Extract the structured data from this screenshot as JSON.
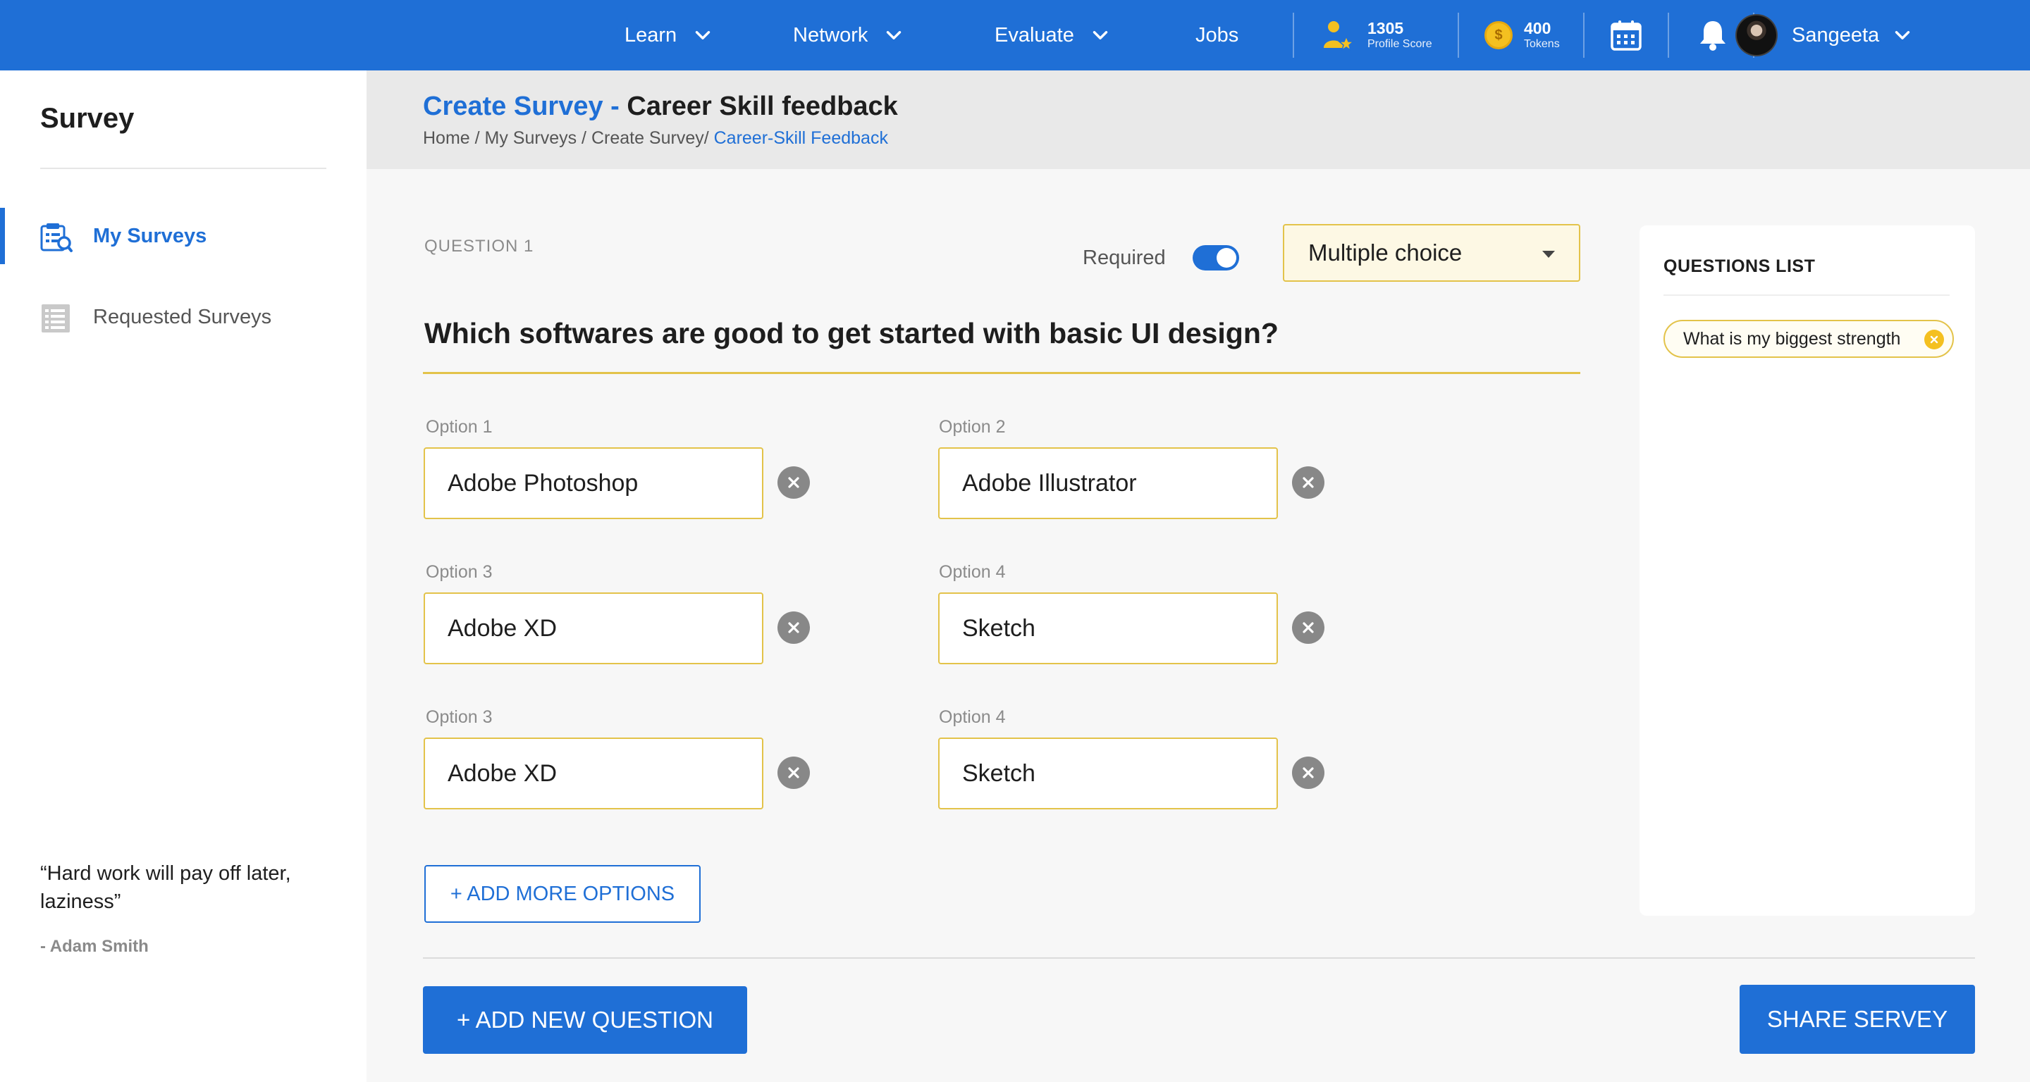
{
  "nav": {
    "items": [
      {
        "label": "Learn",
        "dropdown": true
      },
      {
        "label": "Network",
        "dropdown": true
      },
      {
        "label": "Evaluate",
        "dropdown": true
      },
      {
        "label": "Jobs",
        "dropdown": false
      }
    ],
    "profile_score": {
      "value": "1305",
      "label": "Profile Score",
      "icon": "profile-score-icon"
    },
    "tokens": {
      "value": "400",
      "label": "Tokens",
      "icon": "coin-icon",
      "coin_symbol": "$"
    },
    "user": {
      "name": "Sangeeta"
    },
    "colors": {
      "bar": "#1f6fd6",
      "accent_yellow": "#e3c34a"
    }
  },
  "sidebar": {
    "title": "Survey",
    "items": [
      {
        "label": "My Surveys",
        "active": true,
        "icon": "survey-search-icon"
      },
      {
        "label": "Requested Surveys",
        "active": false,
        "icon": "list-document-icon"
      }
    ],
    "quote": "“Hard work will pay off later, laziness”",
    "author": "- Adam Smith"
  },
  "header": {
    "title_accent": "Create Survey",
    "title_sep": " - ",
    "title_rest": "Career Skill feedback",
    "breadcrumb_prefix": "Home / My Surveys / Create Survey/ ",
    "breadcrumb_current": "Career-Skill Feedback"
  },
  "question": {
    "number_label": "QUESTION 1",
    "required_label": "Required",
    "required": true,
    "type": "Multiple choice",
    "text": "Which softwares are good to get started with basic UI design?",
    "options": [
      {
        "label": "Option 1",
        "value": "Adobe Photoshop"
      },
      {
        "label": "Option 2",
        "value": "Adobe Illustrator"
      },
      {
        "label": "Option 3",
        "value": "Adobe XD"
      },
      {
        "label": "Option 4",
        "value": "Sketch"
      },
      {
        "label": "Option 3",
        "value": "Adobe XD"
      },
      {
        "label": "Option 4",
        "value": "Sketch"
      }
    ],
    "add_options_label": "+ ADD MORE OPTIONS"
  },
  "actions": {
    "add_question_label": "+ ADD NEW QUESTION",
    "share_label": "SHARE SERVEY"
  },
  "questions_list": {
    "title": "QUESTIONS LIST",
    "items": [
      "What is my biggest strength"
    ]
  }
}
